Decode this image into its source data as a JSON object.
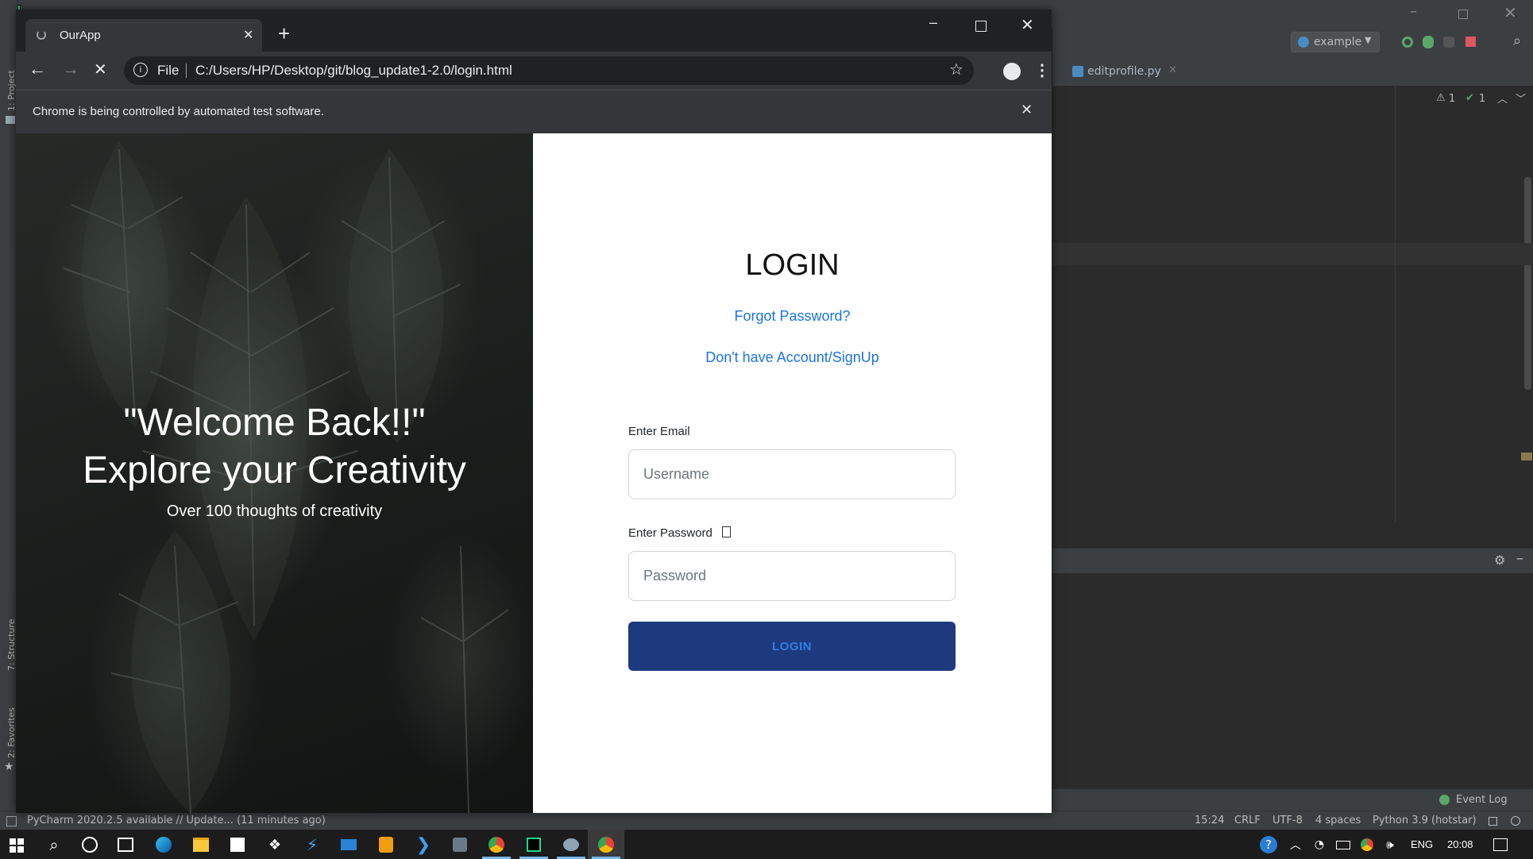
{
  "chrome": {
    "tab_title": "OurApp",
    "url_scheme": "File",
    "url": "C:/Users/HP/Desktop/git/blog_update1-2.0/login.html",
    "infobar_text": "Chrome is being controlled by automated test software."
  },
  "hero": {
    "title_line1": "\"Welcome Back!!\"",
    "title_line2": "Explore your Creativity",
    "subtitle": "Over 100 thoughts of creativity"
  },
  "login": {
    "heading": "LOGIN",
    "forgot_link": "Forgot Password?",
    "signup_link": "Don't have Account/SignUp",
    "email_label": "Enter Email",
    "email_placeholder": "Username",
    "password_label": "Enter Password",
    "password_placeholder": "Password",
    "button_label": "LOGIN"
  },
  "ide": {
    "run_config": "example",
    "editor_tab": "editprofile.py",
    "inspections": {
      "warnings": "1",
      "ok": "1"
    },
    "side_labels": {
      "project": "1: Project",
      "structure": "7: Structure",
      "favorites": "2: Favorites"
    },
    "update_notice": "PyCharm 2020.2.5 available // Update... (11 minutes ago)",
    "event_log": "Event Log",
    "status": {
      "position": "15:24",
      "line_sep": "CRLF",
      "encoding": "UTF-8",
      "indent": "4 spaces",
      "interpreter": "Python 3.9 (hotstar)"
    }
  },
  "taskbar": {
    "language": "ENG",
    "time": "20:08"
  },
  "colors": {
    "login_button_bg": "#1e3a7e",
    "link": "#1a73e8",
    "chrome_dark": "#202124",
    "ide_bg": "#2b2b2b"
  }
}
